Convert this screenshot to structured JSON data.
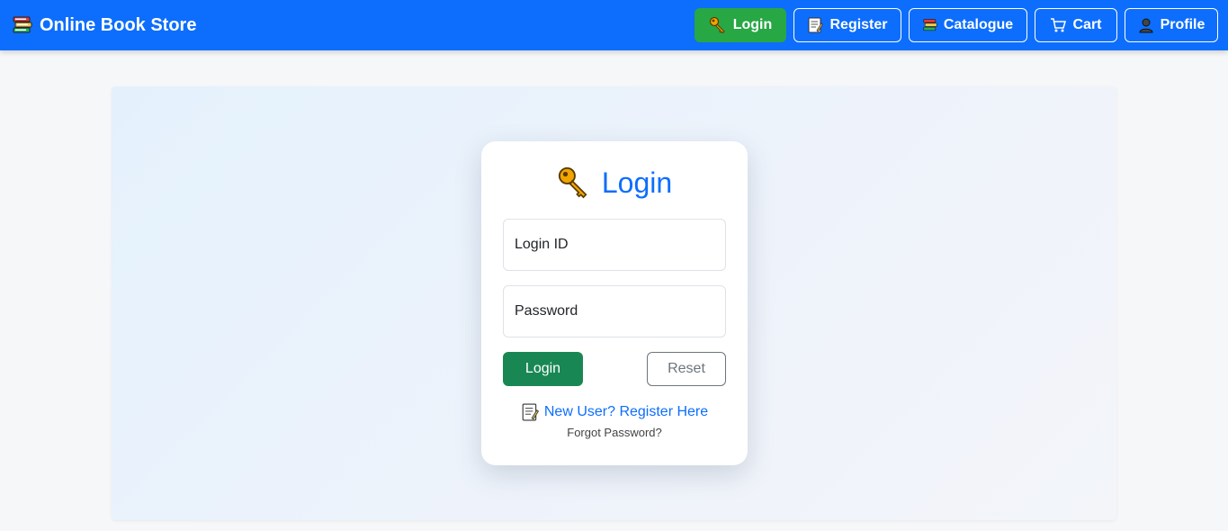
{
  "brand": {
    "title": "Online Book Store",
    "icon": "books-icon"
  },
  "nav": {
    "login": "Login",
    "register": "Register",
    "catalogue": "Catalogue",
    "cart": "Cart",
    "profile": "Profile",
    "active": "Login"
  },
  "login_card": {
    "title": "Login",
    "login_id_placeholder": "Login ID",
    "password_placeholder": "Password",
    "login_button": "Login",
    "reset_button": "Reset",
    "register_link": "New User? Register Here",
    "forgot_password": "Forgot Password?"
  },
  "colors": {
    "navbar": "#0d6efd",
    "active_nav": "#28a745",
    "login_button": "#198754",
    "link": "#0d6efd"
  }
}
